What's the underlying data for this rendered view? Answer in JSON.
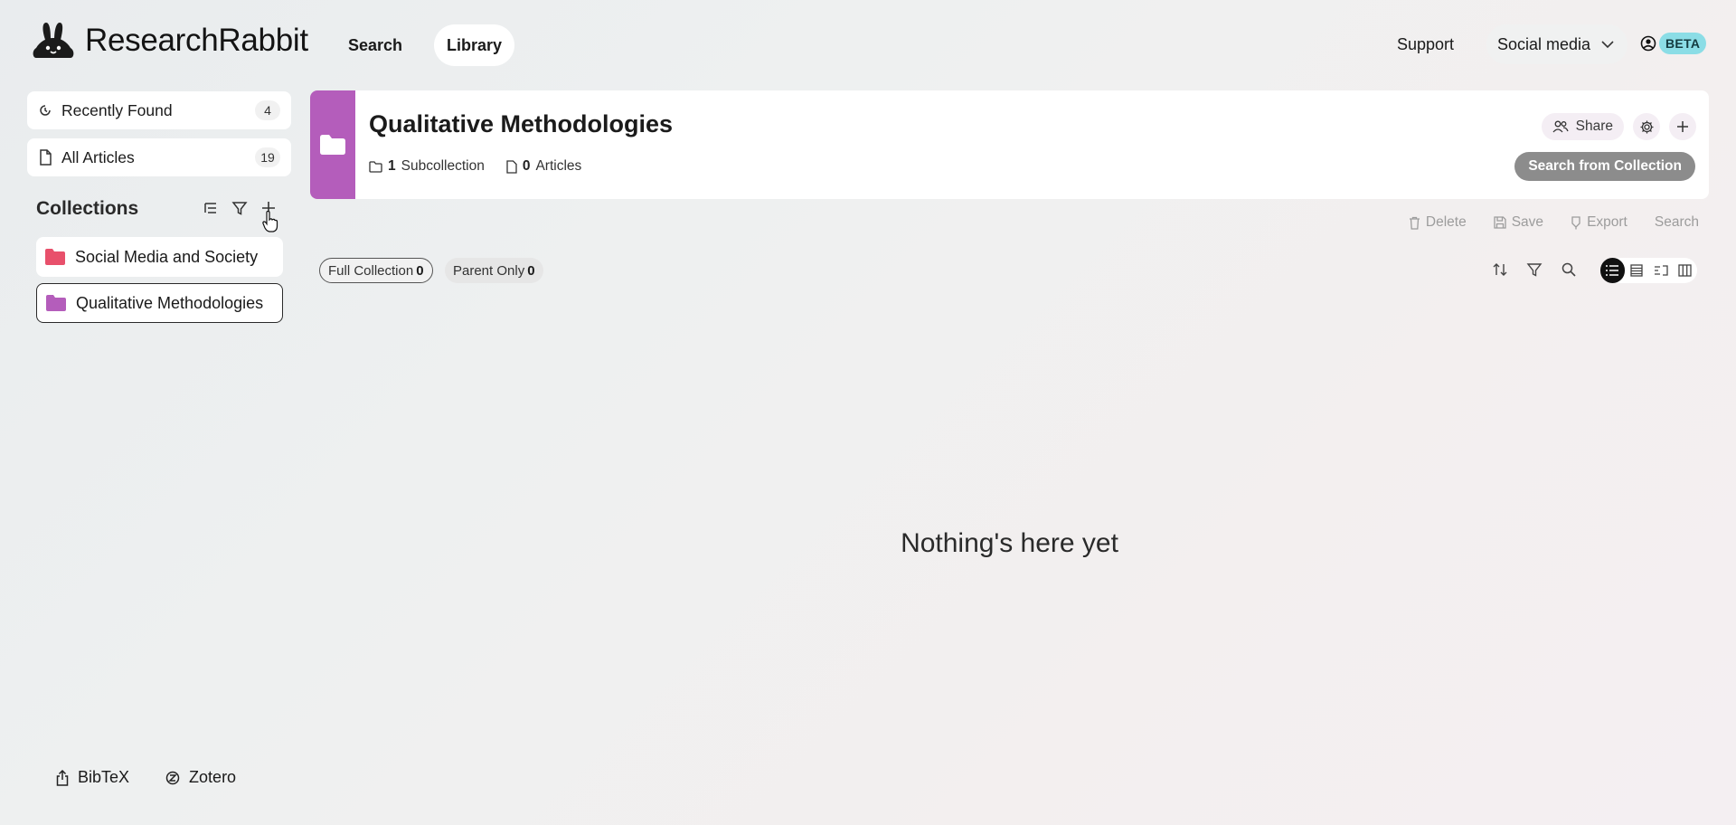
{
  "app": {
    "name": "ResearchRabbit"
  },
  "nav": {
    "search": "Search",
    "library": "Library",
    "support": "Support",
    "project": "Social media",
    "badge": "BETA"
  },
  "sidebar": {
    "recent": {
      "label": "Recently Found",
      "count": "4"
    },
    "all": {
      "label": "All Articles",
      "count": "19"
    },
    "collections_title": "Collections",
    "collections": [
      {
        "label": "Social Media and Society",
        "color": "#e8506b"
      },
      {
        "label": "Qualitative Methodologies",
        "color": "#b45dbb"
      }
    ],
    "bottom": {
      "bibtex": "BibTeX",
      "zotero": "Zotero"
    }
  },
  "collection": {
    "title": "Qualitative Methodologies",
    "subcount": "1",
    "sublabel": "Subcollection",
    "articlecount": "0",
    "articlelabel": "Articles",
    "share": "Share",
    "search_btn": "Search from Collection",
    "color": "#b45dbb"
  },
  "actions": {
    "delete": "Delete",
    "save": "Save",
    "export": "Export",
    "search": "Search"
  },
  "filters": {
    "full_label": "Full Collection",
    "full_count": "0",
    "parent_label": "Parent Only",
    "parent_count": "0"
  },
  "empty_text": "Nothing's here yet"
}
